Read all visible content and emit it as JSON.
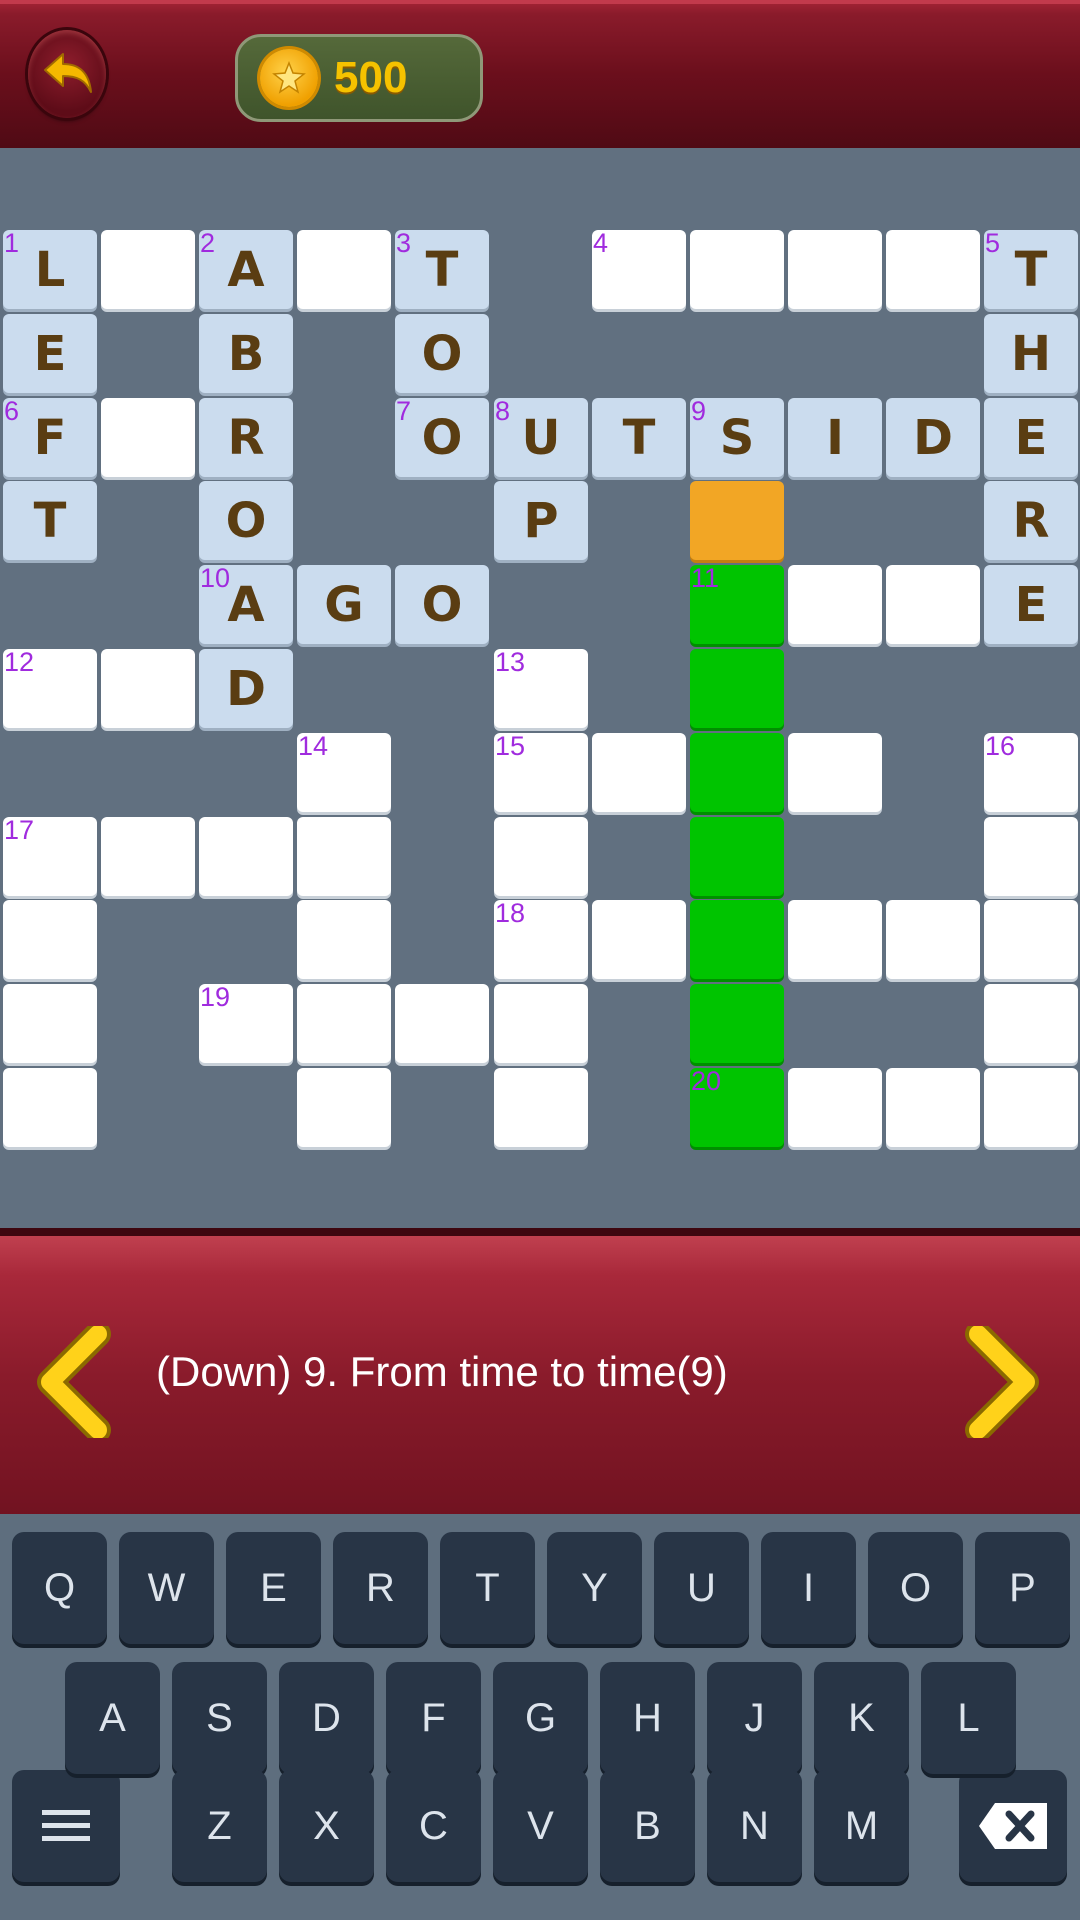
{
  "header": {
    "coins": "500"
  },
  "grid": {
    "cells": [
      {
        "r": 0,
        "c": 0,
        "n": "1",
        "l": "L",
        "s": "filled"
      },
      {
        "r": 0,
        "c": 1,
        "n": "",
        "l": "",
        "s": "white"
      },
      {
        "r": 0,
        "c": 2,
        "n": "2",
        "l": "A",
        "s": "filled"
      },
      {
        "r": 0,
        "c": 3,
        "n": "",
        "l": "",
        "s": "white"
      },
      {
        "r": 0,
        "c": 4,
        "n": "3",
        "l": "T",
        "s": "filled"
      },
      {
        "r": 0,
        "c": 6,
        "n": "4",
        "l": "",
        "s": "white"
      },
      {
        "r": 0,
        "c": 7,
        "n": "",
        "l": "",
        "s": "white"
      },
      {
        "r": 0,
        "c": 8,
        "n": "",
        "l": "",
        "s": "white"
      },
      {
        "r": 0,
        "c": 9,
        "n": "",
        "l": "",
        "s": "white"
      },
      {
        "r": 0,
        "c": 10,
        "n": "5",
        "l": "T",
        "s": "filled"
      },
      {
        "r": 1,
        "c": 0,
        "n": "",
        "l": "E",
        "s": "filled"
      },
      {
        "r": 1,
        "c": 2,
        "n": "",
        "l": "B",
        "s": "filled"
      },
      {
        "r": 1,
        "c": 4,
        "n": "",
        "l": "O",
        "s": "filled"
      },
      {
        "r": 1,
        "c": 10,
        "n": "",
        "l": "H",
        "s": "filled"
      },
      {
        "r": 2,
        "c": 0,
        "n": "6",
        "l": "F",
        "s": "filled"
      },
      {
        "r": 2,
        "c": 1,
        "n": "",
        "l": "",
        "s": "white"
      },
      {
        "r": 2,
        "c": 2,
        "n": "",
        "l": "R",
        "s": "filled"
      },
      {
        "r": 2,
        "c": 4,
        "n": "7",
        "l": "O",
        "s": "filled"
      },
      {
        "r": 2,
        "c": 5,
        "n": "8",
        "l": "U",
        "s": "filled"
      },
      {
        "r": 2,
        "c": 6,
        "n": "",
        "l": "T",
        "s": "filled"
      },
      {
        "r": 2,
        "c": 7,
        "n": "9",
        "l": "S",
        "s": "filled"
      },
      {
        "r": 2,
        "c": 8,
        "n": "",
        "l": "I",
        "s": "filled"
      },
      {
        "r": 2,
        "c": 9,
        "n": "",
        "l": "D",
        "s": "filled"
      },
      {
        "r": 2,
        "c": 10,
        "n": "",
        "l": "E",
        "s": "filled"
      },
      {
        "r": 3,
        "c": 0,
        "n": "",
        "l": "T",
        "s": "filled"
      },
      {
        "r": 3,
        "c": 2,
        "n": "",
        "l": "O",
        "s": "filled"
      },
      {
        "r": 3,
        "c": 5,
        "n": "",
        "l": "P",
        "s": "filled"
      },
      {
        "r": 3,
        "c": 7,
        "n": "",
        "l": "",
        "s": "current"
      },
      {
        "r": 3,
        "c": 10,
        "n": "",
        "l": "R",
        "s": "filled"
      },
      {
        "r": 4,
        "c": 2,
        "n": "10",
        "l": "A",
        "s": "filled"
      },
      {
        "r": 4,
        "c": 3,
        "n": "",
        "l": "G",
        "s": "filled"
      },
      {
        "r": 4,
        "c": 4,
        "n": "",
        "l": "O",
        "s": "filled"
      },
      {
        "r": 4,
        "c": 7,
        "n": "11",
        "l": "",
        "s": "active"
      },
      {
        "r": 4,
        "c": 8,
        "n": "",
        "l": "",
        "s": "white"
      },
      {
        "r": 4,
        "c": 9,
        "n": "",
        "l": "",
        "s": "white"
      },
      {
        "r": 4,
        "c": 10,
        "n": "",
        "l": "E",
        "s": "filled"
      },
      {
        "r": 5,
        "c": 0,
        "n": "12",
        "l": "",
        "s": "white"
      },
      {
        "r": 5,
        "c": 1,
        "n": "",
        "l": "",
        "s": "white"
      },
      {
        "r": 5,
        "c": 2,
        "n": "",
        "l": "D",
        "s": "filled"
      },
      {
        "r": 5,
        "c": 5,
        "n": "13",
        "l": "",
        "s": "white"
      },
      {
        "r": 5,
        "c": 7,
        "n": "",
        "l": "",
        "s": "active"
      },
      {
        "r": 6,
        "c": 3,
        "n": "14",
        "l": "",
        "s": "white"
      },
      {
        "r": 6,
        "c": 5,
        "n": "15",
        "l": "",
        "s": "white"
      },
      {
        "r": 6,
        "c": 6,
        "n": "",
        "l": "",
        "s": "white"
      },
      {
        "r": 6,
        "c": 7,
        "n": "",
        "l": "",
        "s": "active"
      },
      {
        "r": 6,
        "c": 8,
        "n": "",
        "l": "",
        "s": "white"
      },
      {
        "r": 6,
        "c": 10,
        "n": "16",
        "l": "",
        "s": "white"
      },
      {
        "r": 7,
        "c": 0,
        "n": "17",
        "l": "",
        "s": "white"
      },
      {
        "r": 7,
        "c": 1,
        "n": "",
        "l": "",
        "s": "white"
      },
      {
        "r": 7,
        "c": 2,
        "n": "",
        "l": "",
        "s": "white"
      },
      {
        "r": 7,
        "c": 3,
        "n": "",
        "l": "",
        "s": "white"
      },
      {
        "r": 7,
        "c": 5,
        "n": "",
        "l": "",
        "s": "white"
      },
      {
        "r": 7,
        "c": 7,
        "n": "",
        "l": "",
        "s": "active"
      },
      {
        "r": 7,
        "c": 10,
        "n": "",
        "l": "",
        "s": "white"
      },
      {
        "r": 8,
        "c": 0,
        "n": "",
        "l": "",
        "s": "white"
      },
      {
        "r": 8,
        "c": 3,
        "n": "",
        "l": "",
        "s": "white"
      },
      {
        "r": 8,
        "c": 5,
        "n": "18",
        "l": "",
        "s": "white"
      },
      {
        "r": 8,
        "c": 6,
        "n": "",
        "l": "",
        "s": "white"
      },
      {
        "r": 8,
        "c": 7,
        "n": "",
        "l": "",
        "s": "active"
      },
      {
        "r": 8,
        "c": 8,
        "n": "",
        "l": "",
        "s": "white"
      },
      {
        "r": 8,
        "c": 9,
        "n": "",
        "l": "",
        "s": "white"
      },
      {
        "r": 8,
        "c": 10,
        "n": "",
        "l": "",
        "s": "white"
      },
      {
        "r": 9,
        "c": 0,
        "n": "",
        "l": "",
        "s": "white"
      },
      {
        "r": 9,
        "c": 2,
        "n": "19",
        "l": "",
        "s": "white"
      },
      {
        "r": 9,
        "c": 3,
        "n": "",
        "l": "",
        "s": "white"
      },
      {
        "r": 9,
        "c": 4,
        "n": "",
        "l": "",
        "s": "white"
      },
      {
        "r": 9,
        "c": 5,
        "n": "",
        "l": "",
        "s": "white"
      },
      {
        "r": 9,
        "c": 7,
        "n": "",
        "l": "",
        "s": "active"
      },
      {
        "r": 9,
        "c": 10,
        "n": "",
        "l": "",
        "s": "white"
      },
      {
        "r": 10,
        "c": 0,
        "n": "",
        "l": "",
        "s": "white"
      },
      {
        "r": 10,
        "c": 3,
        "n": "",
        "l": "",
        "s": "white"
      },
      {
        "r": 10,
        "c": 5,
        "n": "",
        "l": "",
        "s": "white"
      },
      {
        "r": 10,
        "c": 7,
        "n": "20",
        "l": "",
        "s": "active"
      },
      {
        "r": 10,
        "c": 8,
        "n": "",
        "l": "",
        "s": "white"
      },
      {
        "r": 10,
        "c": 9,
        "n": "",
        "l": "",
        "s": "white"
      },
      {
        "r": 10,
        "c": 10,
        "n": "",
        "l": "",
        "s": "white"
      }
    ]
  },
  "clue": {
    "text": "(Down) 9. From time to time(9)"
  },
  "keyboard": {
    "row1": [
      "Q",
      "W",
      "E",
      "R",
      "T",
      "Y",
      "U",
      "I",
      "O",
      "P"
    ],
    "row2": [
      "A",
      "S",
      "D",
      "F",
      "G",
      "H",
      "J",
      "K",
      "L"
    ],
    "row3": [
      "Z",
      "X",
      "C",
      "V",
      "B",
      "N",
      "M"
    ]
  },
  "colors": {
    "header": "#6b0f1c",
    "grid_bg": "#617080",
    "filled_cell": "#cbdcee",
    "active_word": "#00c400",
    "current_cell": "#f2a625",
    "clue_number": "#a02bde",
    "key_bg": "#283546"
  },
  "icons": {
    "back": "back-arrow-icon",
    "coin": "star-coin-icon",
    "prev": "chevron-left-icon",
    "next": "chevron-right-icon",
    "menu": "menu-icon",
    "delete": "backspace-icon"
  }
}
